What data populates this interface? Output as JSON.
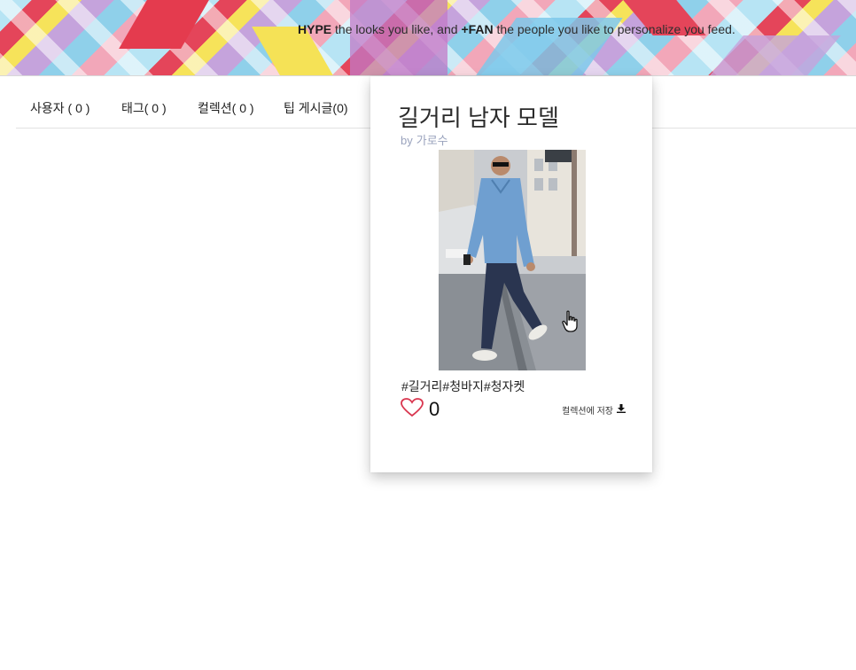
{
  "banner": {
    "tagline": {
      "hype": "HYPE",
      "part1": " the looks you like, and ",
      "fan": "+FAN",
      "part2": " the people you like to personalize you feed."
    }
  },
  "tabs": [
    {
      "label": "사용자 ( 0 )"
    },
    {
      "label": "태그( 0 )"
    },
    {
      "label": "컬렉션( 0 )"
    },
    {
      "label": "팁 게시글(0)"
    }
  ],
  "card": {
    "title": "길거리 남자 모델",
    "author_prefix": "by",
    "author": "가로수",
    "photo_icon": "man-walking-photo",
    "hashtags": "#길거리#청바지#청자켓",
    "like_icon": "heart-outline-icon",
    "like_count": "0",
    "save_label": "컬렉션에 저장",
    "save_icon": "download-icon"
  },
  "colors": {
    "author": "#9aa3bd",
    "heart": "#d9364f"
  }
}
